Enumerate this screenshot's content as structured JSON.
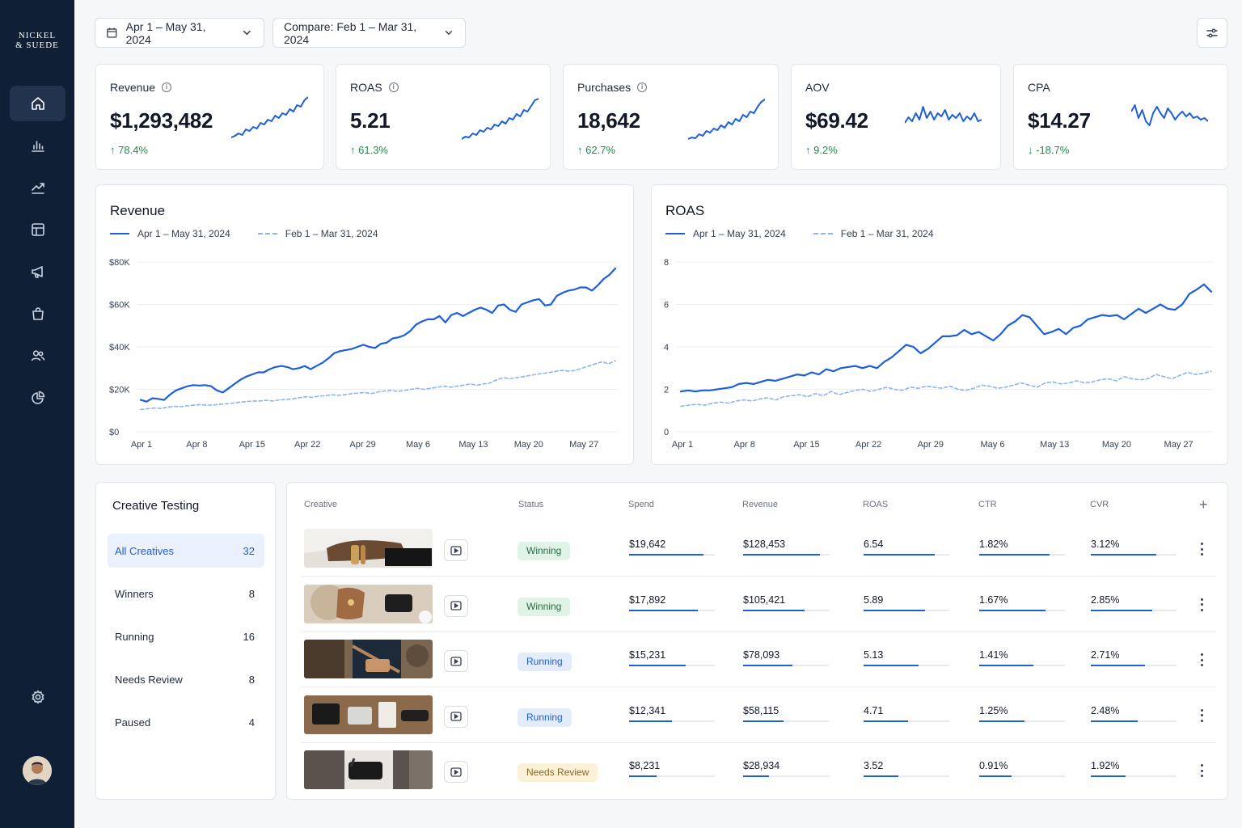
{
  "brand": {
    "logo_line1": "NICKEL",
    "logo_line2": "& SUEDE"
  },
  "sidebar": {
    "items": [
      {
        "icon": "home-icon",
        "active": true
      },
      {
        "icon": "bar-chart-icon"
      },
      {
        "icon": "trend-icon"
      },
      {
        "icon": "layout-icon"
      },
      {
        "icon": "megaphone-icon"
      },
      {
        "icon": "shopping-bag-icon"
      },
      {
        "icon": "users-icon"
      },
      {
        "icon": "pie-chart-icon"
      }
    ],
    "settings_icon": "gear-icon"
  },
  "topbar": {
    "date_range": "Apr 1 – May 31, 2024",
    "compare_range": "Compare: Feb 1 – Mar 31, 2024"
  },
  "kpis": [
    {
      "title": "Revenue",
      "info": true,
      "value": "$1,293,482",
      "change": "78.4%",
      "direction": "up"
    },
    {
      "title": "ROAS",
      "info": true,
      "value": "5.21",
      "change": "61.3%",
      "direction": "up"
    },
    {
      "title": "Purchases",
      "info": true,
      "value": "18,642",
      "change": "62.7%",
      "direction": "up"
    },
    {
      "title": "AOV",
      "info": false,
      "value": "$69.42",
      "change": "9.2%",
      "direction": "up"
    },
    {
      "title": "CPA",
      "info": false,
      "value": "$14.27",
      "change": "-18.7%",
      "direction": "down"
    }
  ],
  "colors": {
    "accent": "#1d5fd9",
    "compare": "#8fb3ee",
    "positive": "#1f8a4c",
    "sidebar": "#0f1f36"
  },
  "charts": {
    "revenue": {
      "title": "Revenue",
      "legend_current": "Apr 1 – May 31, 2024",
      "legend_compare": "Feb 1 – Mar 31, 2024"
    },
    "roas": {
      "title": "ROAS",
      "legend_current": "Apr 1 – May 31, 2024",
      "legend_compare": "Feb 1 – Mar 31, 2024"
    }
  },
  "chart_data": [
    {
      "type": "line",
      "title": "Revenue",
      "x_ticks": [
        "Apr 1",
        "Apr 8",
        "Apr 15",
        "Apr 22",
        "Apr 29",
        "May 6",
        "May 13",
        "May 20",
        "May 27"
      ],
      "y_ticks": [
        "$0",
        "$20K",
        "$40K",
        "$60K",
        "$80K"
      ],
      "ylim": [
        0,
        80000
      ],
      "grid": true,
      "legend": "top-left",
      "series": [
        {
          "name": "Apr 1 – May 31, 2024",
          "style": "solid",
          "values": [
            15000,
            14200,
            15800,
            15500,
            15000,
            17500,
            19500,
            20500,
            21500,
            22000,
            21800,
            22000,
            21500,
            19500,
            18500,
            20500,
            22500,
            24500,
            26000,
            27000,
            28000,
            28000,
            29500,
            30500,
            31000,
            30500,
            29500,
            30000,
            31000,
            29500,
            31000,
            32500,
            34500,
            37000,
            38000,
            38500,
            39000,
            40000,
            41000,
            40000,
            39500,
            41500,
            42000,
            44000,
            44500,
            45500,
            47500,
            50500,
            52000,
            53000,
            53000,
            54500,
            51500,
            55000,
            56000,
            54500,
            56000,
            57500,
            58500,
            57500,
            56000,
            59500,
            60000,
            57500,
            56500,
            60000,
            61000,
            62000,
            62500,
            59500,
            60000,
            64000,
            65500,
            66500,
            67000,
            68000,
            68000,
            66500,
            69000,
            72000,
            74000,
            77000
          ]
        },
        {
          "name": "Feb 1 – Mar 31, 2024",
          "style": "dashed",
          "values": [
            10500,
            10800,
            11200,
            11000,
            11500,
            12000,
            11800,
            12200,
            12500,
            12800,
            12500,
            12600,
            13000,
            13200,
            13500,
            14000,
            14200,
            14500,
            14500,
            14800,
            14500,
            15000,
            15200,
            15500,
            16000,
            16500,
            16200,
            16800,
            17000,
            17500,
            17200,
            17500,
            18000,
            18200,
            18500,
            18000,
            18800,
            19200,
            19500,
            19000,
            19500,
            20000,
            20500,
            20000,
            20500,
            21000,
            21500,
            21000,
            21500,
            22000,
            22500,
            22000,
            22500,
            23000,
            24500,
            25500,
            25000,
            25500,
            26000,
            26500,
            27000,
            27500,
            28000,
            28500,
            29000,
            28500,
            29000,
            30000,
            31000,
            32000,
            33000,
            32000,
            33500
          ]
        }
      ]
    },
    {
      "type": "line",
      "title": "ROAS",
      "x_ticks": [
        "Apr 1",
        "Apr 8",
        "Apr 15",
        "Apr 22",
        "Apr 29",
        "May 6",
        "May 13",
        "May 20",
        "May 27"
      ],
      "y_ticks": [
        "0",
        "2",
        "4",
        "6",
        "8"
      ],
      "ylim": [
        0,
        8
      ],
      "grid": true,
      "legend": "top-left",
      "series": [
        {
          "name": "Apr 1 – May 31, 2024",
          "style": "solid",
          "values": [
            1.9,
            1.95,
            1.9,
            1.95,
            1.95,
            2.0,
            2.05,
            2.1,
            2.25,
            2.3,
            2.25,
            2.35,
            2.45,
            2.4,
            2.5,
            2.6,
            2.7,
            2.65,
            2.8,
            2.7,
            2.95,
            2.85,
            3.0,
            3.05,
            3.1,
            3.0,
            3.1,
            3.0,
            3.3,
            3.5,
            3.8,
            4.1,
            4.0,
            3.7,
            3.9,
            4.2,
            4.5,
            4.5,
            4.55,
            4.8,
            4.6,
            4.7,
            4.5,
            4.3,
            4.6,
            5.0,
            5.2,
            5.5,
            5.4,
            5.0,
            4.6,
            4.7,
            4.85,
            4.6,
            4.9,
            5.0,
            5.3,
            5.4,
            5.5,
            5.45,
            5.5,
            5.3,
            5.55,
            5.8,
            5.6,
            5.8,
            6.0,
            5.8,
            5.75,
            6.0,
            6.5,
            6.7,
            6.95,
            6.6
          ]
        },
        {
          "name": "Feb 1 – Mar 31, 2024",
          "style": "dashed",
          "values": [
            1.2,
            1.25,
            1.3,
            1.25,
            1.35,
            1.4,
            1.35,
            1.45,
            1.5,
            1.45,
            1.55,
            1.6,
            1.5,
            1.65,
            1.7,
            1.75,
            1.65,
            1.8,
            1.7,
            1.9,
            1.75,
            1.85,
            1.95,
            2.0,
            1.9,
            2.0,
            2.1,
            2.0,
            1.95,
            2.1,
            2.05,
            2.15,
            2.1,
            2.05,
            2.15,
            2.0,
            1.95,
            2.05,
            2.2,
            2.15,
            2.05,
            2.1,
            2.2,
            2.3,
            2.2,
            2.1,
            2.3,
            2.35,
            2.25,
            2.3,
            2.4,
            2.3,
            2.35,
            2.45,
            2.5,
            2.4,
            2.6,
            2.5,
            2.45,
            2.5,
            2.7,
            2.6,
            2.5,
            2.65,
            2.8,
            2.7,
            2.75,
            2.85
          ]
        }
      ]
    }
  ],
  "creative_testing": {
    "title": "Creative Testing",
    "filters": [
      {
        "label": "All Creatives",
        "count": "32",
        "active": true
      },
      {
        "label": "Winners",
        "count": "8"
      },
      {
        "label": "Running",
        "count": "16"
      },
      {
        "label": "Needs Review",
        "count": "8"
      },
      {
        "label": "Paused",
        "count": "4"
      }
    ]
  },
  "table": {
    "columns": [
      "Creative",
      "Status",
      "Spend",
      "Revenue",
      "ROAS",
      "CTR",
      "CVR"
    ],
    "add_icon": "plus-icon",
    "rows": [
      {
        "status": "Winning",
        "status_kind": "win",
        "spend": "$19,642",
        "revenue": "$128,453",
        "roas": "6.54",
        "ctr": "1.82%",
        "cvr": "3.12%",
        "fills": [
          0.87,
          0.9,
          0.83,
          0.82,
          0.76
        ]
      },
      {
        "status": "Winning",
        "status_kind": "win",
        "spend": "$17,892",
        "revenue": "$105,421",
        "roas": "5.89",
        "ctr": "1.67%",
        "cvr": "2.85%",
        "fills": [
          0.8,
          0.72,
          0.72,
          0.77,
          0.72
        ]
      },
      {
        "status": "Running",
        "status_kind": "run",
        "spend": "$15,231",
        "revenue": "$78,093",
        "roas": "5.13",
        "ctr": "1.41%",
        "cvr": "2.71%",
        "fills": [
          0.66,
          0.58,
          0.64,
          0.63,
          0.63
        ]
      },
      {
        "status": "Running",
        "status_kind": "run",
        "spend": "$12,341",
        "revenue": "$58,115",
        "roas": "4.71",
        "ctr": "1.25%",
        "cvr": "2.48%",
        "fills": [
          0.5,
          0.47,
          0.52,
          0.53,
          0.55
        ]
      },
      {
        "status": "Needs Review",
        "status_kind": "rev",
        "spend": "$8,231",
        "revenue": "$28,934",
        "roas": "3.52",
        "ctr": "0.91%",
        "cvr": "1.92%",
        "fills": [
          0.32,
          0.3,
          0.41,
          0.38,
          0.41
        ]
      }
    ]
  }
}
